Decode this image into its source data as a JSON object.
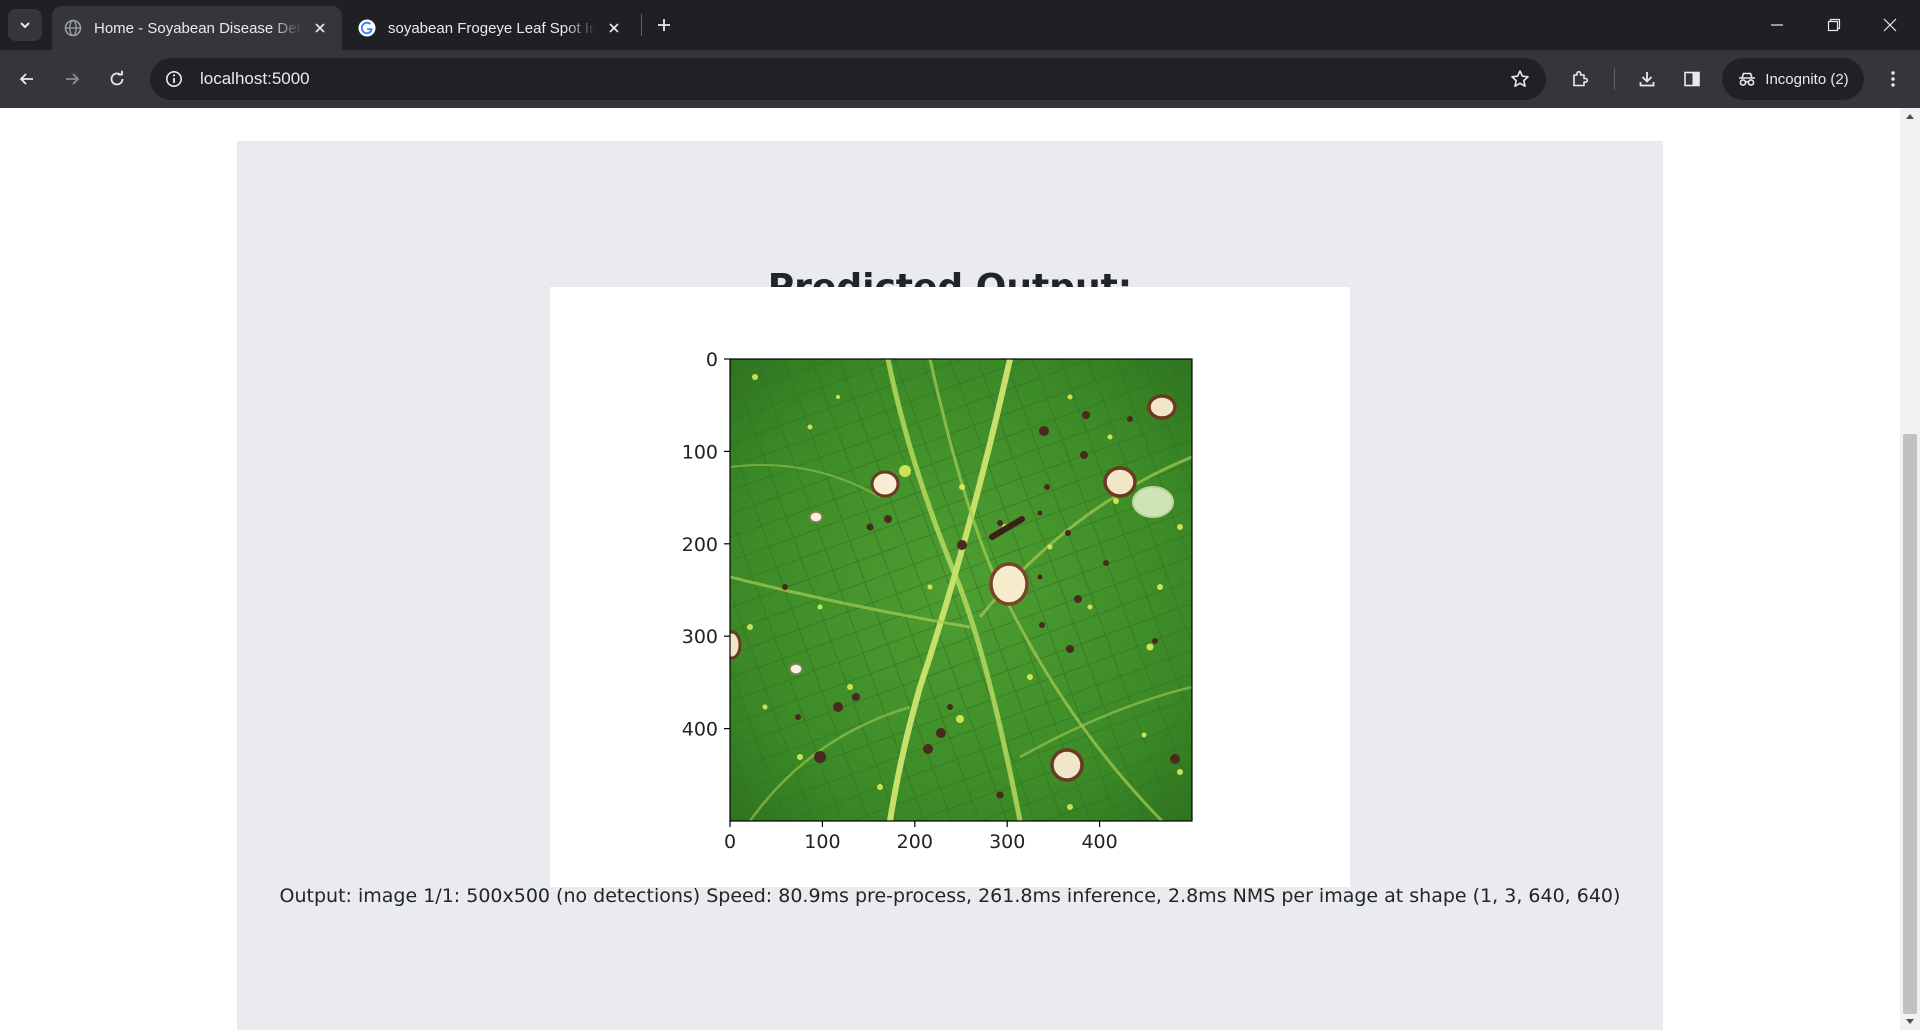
{
  "browser": {
    "tabs": [
      {
        "title": "Home - Soyabean Disease Dete",
        "favicon": "globe-icon",
        "active": true
      },
      {
        "title": "soyabean Frogeye Leaf Spot Im",
        "favicon": "google-g-icon",
        "active": false
      }
    ],
    "url": "localhost:5000",
    "incognito_label": "Incognito (2)"
  },
  "page": {
    "heading": "Predicted Output:",
    "caption": "Output: image 1/1: 500x500 (no detections) Speed: 80.9ms pre-process, 261.8ms inference, 2.8ms NMS per image at shape (1, 3, 640, 640)"
  },
  "chart_data": {
    "type": "image",
    "x_ticks": [
      "0",
      "100",
      "200",
      "300",
      "400"
    ],
    "y_ticks": [
      "0",
      "100",
      "200",
      "300",
      "400"
    ],
    "xlim": [
      0,
      500
    ],
    "ylim": [
      500,
      0
    ],
    "image_description_visible": "green soybean leaf with frogeye leaf spot lesions"
  },
  "colors": {
    "leaf_green": "#3f8f2a",
    "vein": "#b8d860",
    "lesion_dark": "#4a2a1e",
    "lesion_light": "#f1e6c8"
  }
}
